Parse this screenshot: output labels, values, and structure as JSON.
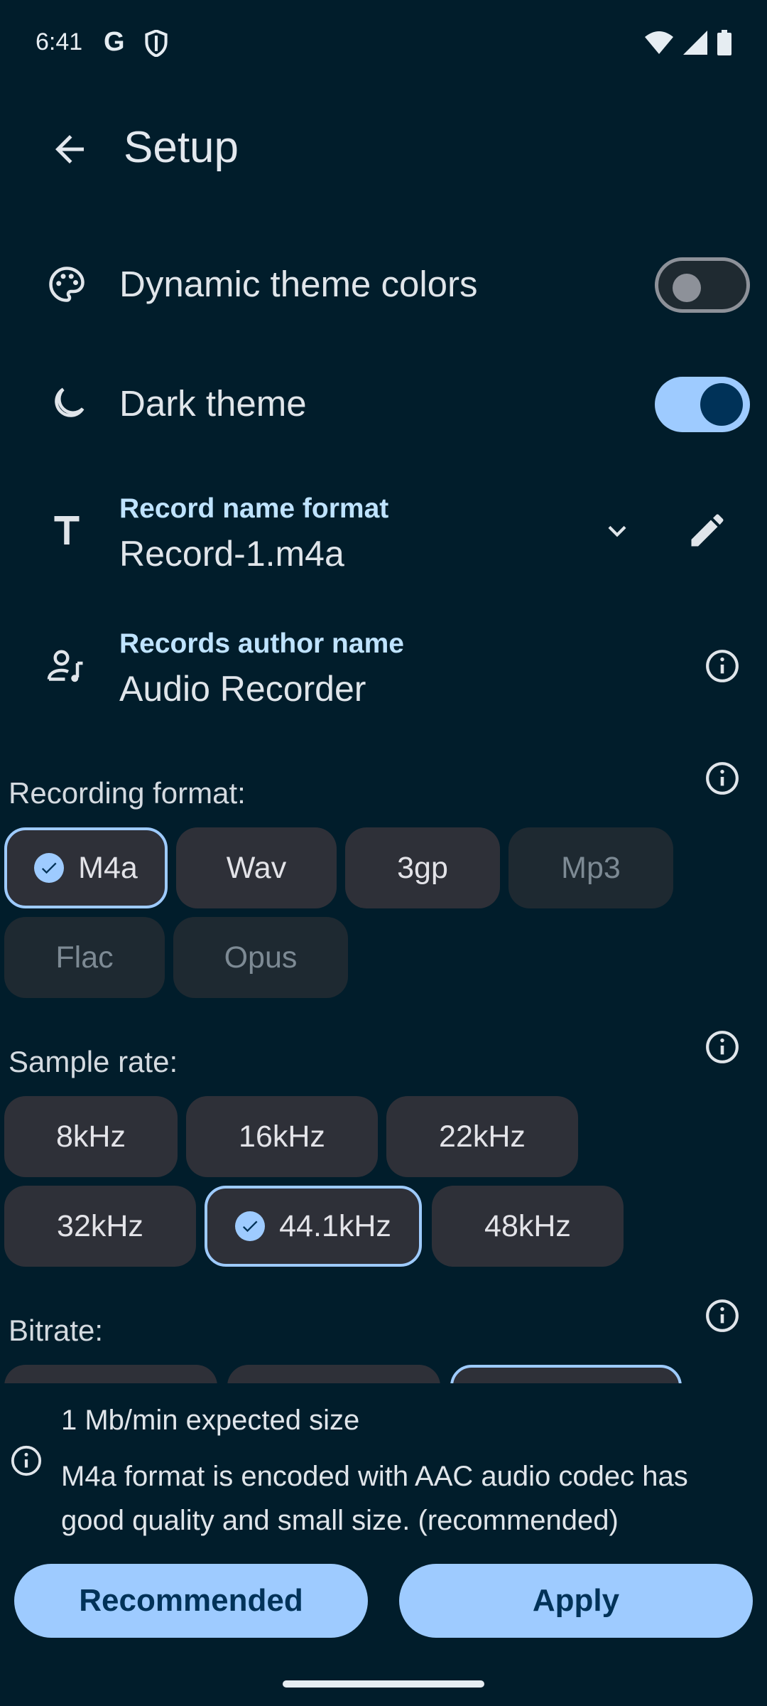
{
  "status": {
    "time": "6:41",
    "g_label": "G"
  },
  "header": {
    "title": "Setup"
  },
  "settings": {
    "dynamic_theme": {
      "label": "Dynamic theme colors",
      "enabled": false
    },
    "dark_theme": {
      "label": "Dark theme",
      "enabled": true
    },
    "record_name_format": {
      "heading": "Record name format",
      "value": "Record-1.m4a"
    },
    "author_name": {
      "heading": "Records author name",
      "value": "Audio Recorder"
    }
  },
  "recording_format": {
    "label": "Recording format:",
    "options": [
      "M4a",
      "Wav",
      "3gp",
      "Mp3",
      "Flac",
      "Opus"
    ],
    "selected": "M4a",
    "disabled": [
      "Mp3",
      "Flac",
      "Opus"
    ]
  },
  "sample_rate": {
    "label": "Sample rate:",
    "options": [
      "8kHz",
      "16kHz",
      "22kHz",
      "32kHz",
      "44.1kHz",
      "48kHz"
    ],
    "selected": "44.1kHz"
  },
  "bitrate": {
    "label": "Bitrate:"
  },
  "info_panel": {
    "expected_size": "1 Mb/min expected size",
    "description": "M4a format is encoded with AAC audio codec has good quality and small size. (recommended)"
  },
  "buttons": {
    "recommended": "Recommended",
    "apply": "Apply"
  },
  "colors": {
    "background": "#011d2b",
    "accent": "#9ecbff",
    "chip": "#2e3038"
  }
}
